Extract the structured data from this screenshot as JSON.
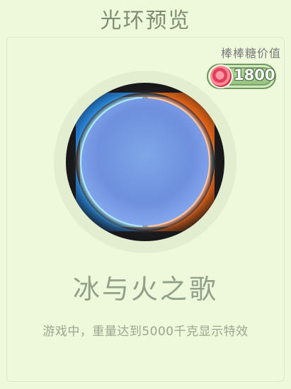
{
  "header": {
    "title": "光环预览"
  },
  "value": {
    "label": "棒棒糖价值",
    "amount": "1800",
    "icon": "lollipop-candy-icon"
  },
  "halo": {
    "name": "冰与火之歌",
    "description": "游戏中，重量达到5000千克显示特效",
    "colors": {
      "ice": "#46d6ff",
      "fire": "#ff8a3a",
      "core": "#6e90dd"
    }
  }
}
